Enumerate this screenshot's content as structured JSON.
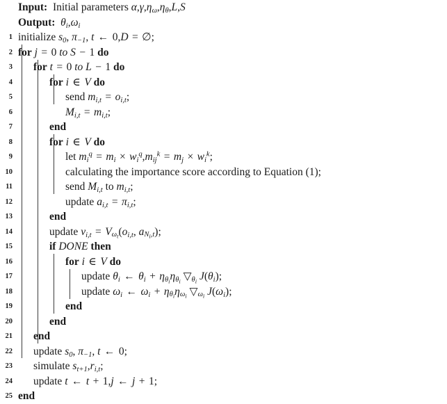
{
  "document": {
    "type": "algorithm-pseudocode",
    "background_color": "#ffffff",
    "text_color": "#1a1a1a",
    "guide_color": "#3a3a3a"
  },
  "header": {
    "input_label": "Input:",
    "input_text": "Initial parameters α,γ,ηω,ηθ,L,S",
    "output_label": "Output:",
    "output_text": "θi,ωi"
  },
  "lines": [
    {
      "number": "1",
      "indent": 0,
      "text": "initialize s0, π−1, t ← 0,D = ∅;"
    },
    {
      "number": "2",
      "indent": 0,
      "text": "for j = 0 to S − 1 do"
    },
    {
      "number": "3",
      "indent": 1,
      "text": "for t = 0 to L − 1 do"
    },
    {
      "number": "4",
      "indent": 2,
      "text": "for i ∈ V do"
    },
    {
      "number": "5",
      "indent": 3,
      "text": "send mi,t = oi,t;"
    },
    {
      "number": "6",
      "indent": 3,
      "text": "Mi,t = mi,t;"
    },
    {
      "number": "7",
      "indent": 2,
      "text": "end"
    },
    {
      "number": "8",
      "indent": 2,
      "text": "for i ∈ V do"
    },
    {
      "number": "9",
      "indent": 3,
      "text": "let miq = mi × wiq,mijk = mj × wik;"
    },
    {
      "number": "10",
      "indent": 3,
      "text": "calculating the importance score according to Equation (1);"
    },
    {
      "number": "11",
      "indent": 3,
      "text": "send Mi,t to mi,t;"
    },
    {
      "number": "12",
      "indent": 3,
      "text": "update ai,t = πi,t;"
    },
    {
      "number": "13",
      "indent": 2,
      "text": "end"
    },
    {
      "number": "14",
      "indent": 2,
      "text": "update vi,t = Vωt(oi,t, aNi,t);"
    },
    {
      "number": "15",
      "indent": 2,
      "text": "if DONE then"
    },
    {
      "number": "16",
      "indent": 3,
      "text": "for i ∈ V do"
    },
    {
      "number": "17",
      "indent": 4,
      "text": "update θi ← θi + ηθiηθi ∇θi J(θi);"
    },
    {
      "number": "18",
      "indent": 4,
      "text": "update ωi ← ωi + ηθiηωi ∇ωi J(ωi);"
    },
    {
      "number": "19",
      "indent": 3,
      "text": "end"
    },
    {
      "number": "20",
      "indent": 2,
      "text": "end"
    },
    {
      "number": "21",
      "indent": 1,
      "text": "end"
    },
    {
      "number": "22",
      "indent": 1,
      "text": "update s0, π−1, t ← 0;"
    },
    {
      "number": "23",
      "indent": 1,
      "text": "simulate st+1, ri,t;"
    },
    {
      "number": "24",
      "indent": 1,
      "text": "update t ← t + 1,j ← j + 1;"
    },
    {
      "number": "25",
      "indent": 0,
      "text": "end"
    }
  ],
  "keywords": {
    "for": "for",
    "do": "do",
    "end": "end",
    "if": "if",
    "then": "then",
    "to": "to",
    "done": "DONE"
  },
  "symbols": {
    "assign_arrow": "←",
    "element_of": "∈",
    "empty_set": "∅",
    "times": "×",
    "nabla": "▽",
    "minus": "−",
    "plus": "+",
    "equals": "="
  }
}
